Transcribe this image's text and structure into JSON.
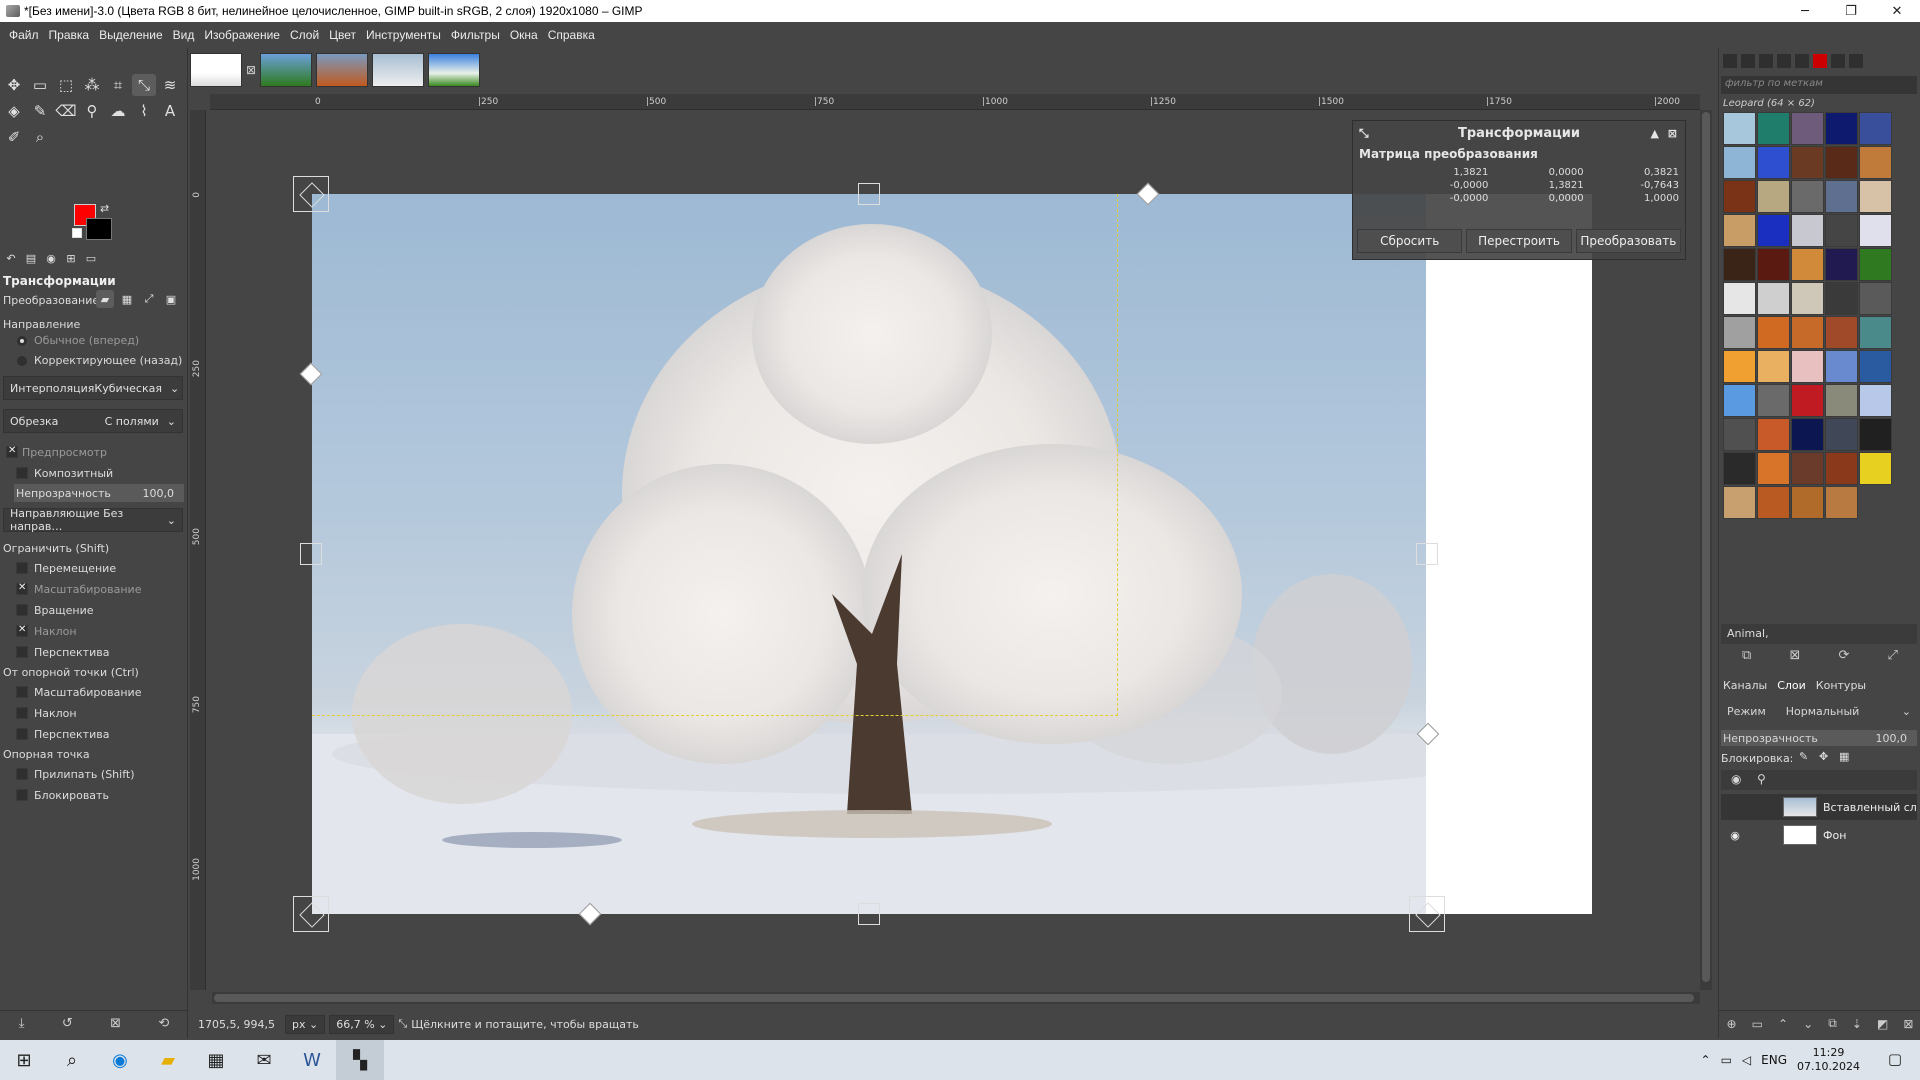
{
  "window": {
    "title": "*[Без имени]-3.0 (Цвета RGB 8 бит, нелинейное целочисленное, GIMP built-in sRGB, 2 слоя) 1920x1080 – GIMP"
  },
  "menu": [
    "Файл",
    "Правка",
    "Выделение",
    "Вид",
    "Изображение",
    "Слой",
    "Цвет",
    "Инструменты",
    "Фильтры",
    "Окна",
    "Справка"
  ],
  "colors": {
    "foreground": "#ff0000",
    "background": "#000000",
    "accent_selection": "#e3cf2e"
  },
  "tool_options": {
    "title": "Трансформации",
    "transform_label": "Преобразование:",
    "direction_label": "Направление",
    "direction_normal": "Обычное (вперед)",
    "direction_corrective": "Корректирующее (назад)",
    "interpolation_label": "Интерполяция",
    "interpolation_value": "Кубическая",
    "clipping_label": "Обрезка",
    "clipping_value": "С полями",
    "preview": "Предпросмотр",
    "composite": "Композитный",
    "opacity_label": "Непрозрачность",
    "opacity_value": "100,0",
    "guides": "Направляющие Без направ…",
    "constrain_label": "Ограничить (Shift)",
    "c_move": "Перемещение",
    "c_scale": "Масштабирование",
    "c_rotate": "Вращение",
    "c_shear": "Наклон",
    "c_perspective": "Перспектива",
    "pivot_label": "От опорной точки  (Ctrl)",
    "p_scale": "Масштабирование",
    "p_shear": "Наклон",
    "p_perspective": "Перспектива",
    "anchor_label": "Опорная точка",
    "snap": "Прилипать (Shift)",
    "lock": "Блокировать"
  },
  "ruler": {
    "h_ticks": [
      "0",
      "|250",
      "|500",
      "|750",
      "|1000",
      "|1250",
      "|1500",
      "|1750",
      "|2000"
    ],
    "v_ticks": [
      "0",
      "250",
      "500",
      "750",
      "1000"
    ]
  },
  "transform_dialog": {
    "title": "Трансформации",
    "subtitle": "Матрица преобразования",
    "matrix": [
      "1,3821",
      "0,0000",
      "0,3821",
      "-0,0000",
      "1,3821",
      "-0,7643",
      "-0,0000",
      "0,0000",
      "1,0000"
    ],
    "reset": "Сбросить",
    "readjust": "Перестроить",
    "transform": "Преобразовать"
  },
  "status": {
    "coords": "1705,5, 994,5",
    "unit": "px",
    "zoom": "66,7 %",
    "message": "Щёлкните и потащите, чтобы вращать"
  },
  "patterns": {
    "filter_placeholder": "фильтр по меткам",
    "name": "Leopard (64 × 62)",
    "tag": "Animal,",
    "swatches": [
      "#a7c7dc",
      "#1e7e6b",
      "#6e5a7a",
      "#0e1a6e",
      "#3a4f9c",
      "#8fb5d6",
      "#2d4fd0",
      "#6a3a22",
      "#5a2a18",
      "#c07a3a",
      "#7a3316",
      "#b8a882",
      "#6a6a6a",
      "#5f6f8f",
      "#d7c2a8",
      "#c99d66",
      "#1a2fc0",
      "#c8c8d0",
      "#454545",
      "#e0e0ec",
      "#3a2418",
      "#5a1a12",
      "#d08a3a",
      "#201a50",
      "#2f7a20",
      "#e6e6e6",
      "#cfcfcf",
      "#cfc8b8",
      "#3a3a3a",
      "#5a5a5a",
      "#a0a0a0",
      "#d06a22",
      "#c66a2a",
      "#a04a2a",
      "#4a8a8a",
      "#f0a030",
      "#e8b060",
      "#e8c0c0",
      "#6a8ad0",
      "#2a5aa0",
      "#5a9ae0",
      "#6a6a6a",
      "#c01a22",
      "#8a8a7a",
      "#b8c8e8",
      "#505050",
      "#c85a2a",
      "#0c1650",
      "#404858",
      "#202020",
      "#2a2a2a",
      "#d8742a",
      "#6a3a2a",
      "#8a3a1a",
      "#e8d020",
      "#c8a070",
      "#b85a22",
      "#b06a2a",
      "#b87a40"
    ]
  },
  "layers": {
    "tabs": [
      "Каналы",
      "Слои",
      "Контуры"
    ],
    "mode_label": "Режим",
    "mode_value": "Нормальный",
    "opacity_label": "Непрозрачность",
    "opacity_value": "100,0",
    "lock_label": "Блокировка:",
    "items": [
      {
        "name": "Вставленный сл"
      },
      {
        "name": "Фон"
      }
    ]
  },
  "taskbar": {
    "lang": "ENG",
    "time": "11:29",
    "date": "07.10.2024"
  }
}
